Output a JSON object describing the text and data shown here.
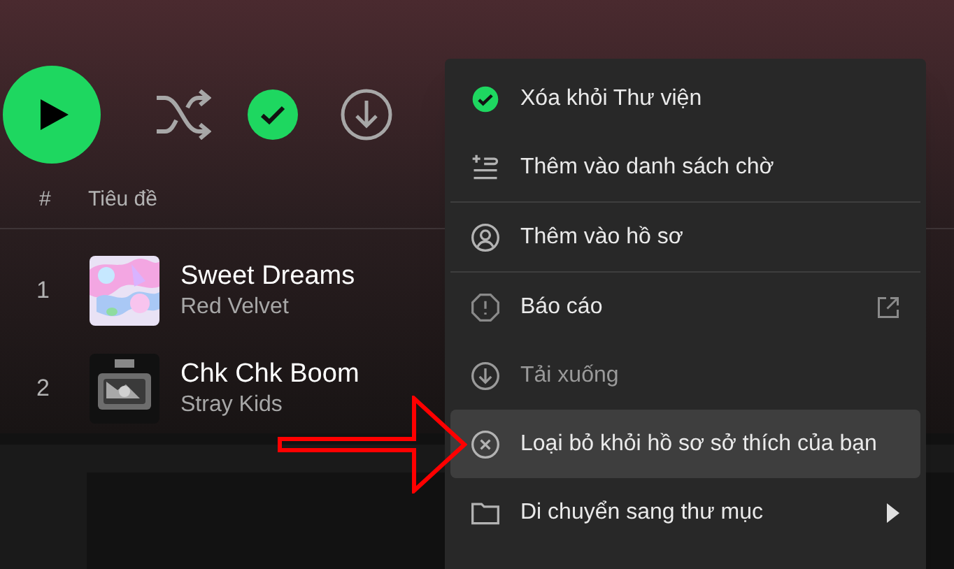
{
  "header": {
    "column_number": "#",
    "column_title": "Tiêu đề"
  },
  "tracks": [
    {
      "number": "1",
      "title": "Sweet Dreams",
      "artist": "Red Velvet"
    },
    {
      "number": "2",
      "title": "Chk Chk Boom",
      "artist": "Stray Kids"
    }
  ],
  "controls": {
    "saved": true
  },
  "menu": [
    {
      "label": "Xóa khỏi Thư viện",
      "selected": false,
      "disabled": false
    },
    {
      "label": "Thêm vào danh sách chờ",
      "selected": false,
      "disabled": false
    },
    {
      "label": "Thêm vào hồ sơ",
      "selected": false,
      "disabled": false
    },
    {
      "label": "Báo cáo",
      "selected": false,
      "disabled": false
    },
    {
      "label": "Tải xuống",
      "selected": false,
      "disabled": true
    },
    {
      "label": "Loại bỏ khỏi hồ sơ sở thích của bạn",
      "selected": true,
      "disabled": false
    },
    {
      "label": "Di chuyển sang thư mục",
      "selected": false,
      "disabled": false
    }
  ]
}
